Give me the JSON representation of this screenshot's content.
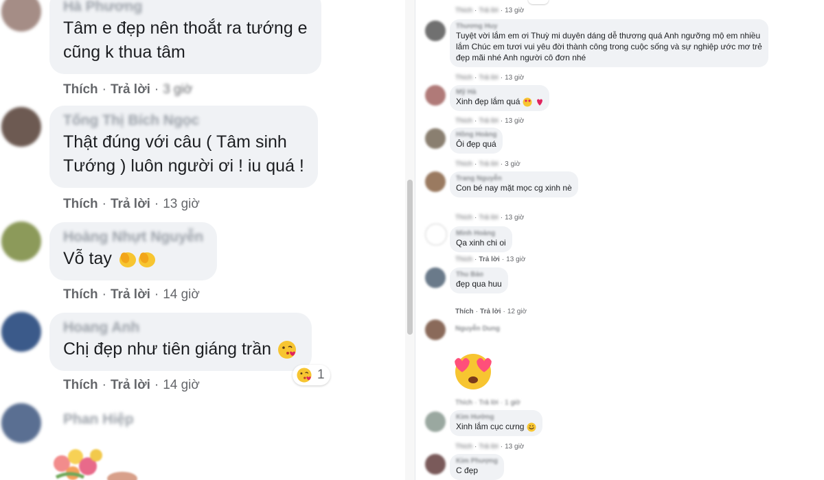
{
  "labels": {
    "like": "Thích",
    "reply": "Trả lời",
    "dot": "·"
  },
  "left_comments": [
    {
      "name": "Hà Phương",
      "lines": [
        "Tâm e đẹp nên thoắt ra tướng e",
        "cũng k thua tâm"
      ],
      "time": "3 giờ",
      "avatar_color": "#a58d86"
    },
    {
      "name": "Tống Thị Bích Ngọc",
      "lines": [
        "Thật đúng với câu ( Tâm sinh",
        "Tướng ) luôn người ơi ! iu quá !"
      ],
      "time": "13 giờ",
      "avatar_color": "#6d5a52"
    },
    {
      "name": "Hoàng Nhựt Nguyễn",
      "lines": [
        "Vỗ tay"
      ],
      "time": "14 giờ",
      "avatar_color": "#8c9a5a"
    },
    {
      "name": "Hoang Anh",
      "lines": [
        "Chị đẹp như tiên giáng trần"
      ],
      "time": "14 giờ",
      "avatar_color": "#3b5a8a",
      "reaction_count": "1"
    },
    {
      "name": "Phan Hiệp",
      "lines": [],
      "avatar_color": "#5a6f92"
    }
  ],
  "right_comments": [
    {
      "time": "13 giờ"
    },
    {
      "name": "Thương Huy",
      "lines": [
        "Tuyệt vời lắm em ơi Thuỳ mi duyên dáng dễ thương quá Anh ngưỡng mộ em nhiều",
        "lắm Chúc em tươi vui yêu đời thành công trong cuộc sống và sự nghiệp ước mơ trẻ",
        "đẹp mãi nhé Anh người cô đơn nhé"
      ],
      "time": "13 giờ",
      "avatar_color": "#707070"
    },
    {
      "name": "Mỹ Hà",
      "lines": [
        "Xinh đẹp lắm quá"
      ],
      "time": "13 giờ",
      "avatar_color": "#b07a78"
    },
    {
      "name": "Hồng Hoàng",
      "lines": [
        "Ôi đẹp quá"
      ],
      "time": "3 giờ",
      "avatar_color": "#8a7f70"
    },
    {
      "name": "Trang Nguyễn",
      "lines": [
        "Con bé nay mặt mọc cg xinh nè"
      ],
      "time": "13 giờ",
      "avatar_color": "#9a7a60"
    },
    {
      "name": "Minh Hoàng",
      "lines": [
        "Qa xinh chi oi"
      ],
      "time": "13 giờ",
      "avatar_color": "#cfcfcf"
    },
    {
      "name": "Thu Bảo",
      "lines": [
        "đẹp qua huu"
      ],
      "time": "12 giờ",
      "avatar_color": "#6a7a8a"
    },
    {
      "name": "Nguyễn Dung",
      "lines": [],
      "time": "1 giờ",
      "avatar_color": "#8a6a5a"
    },
    {
      "name": "Kim Hường",
      "lines": [
        "Xinh lắm cục cưng"
      ],
      "time": "13 giờ",
      "avatar_color": "#9aa8a0"
    },
    {
      "name": "Kim Phượng",
      "lines": [
        "C đẹp"
      ],
      "avatar_color": "#7a5a5a"
    }
  ]
}
